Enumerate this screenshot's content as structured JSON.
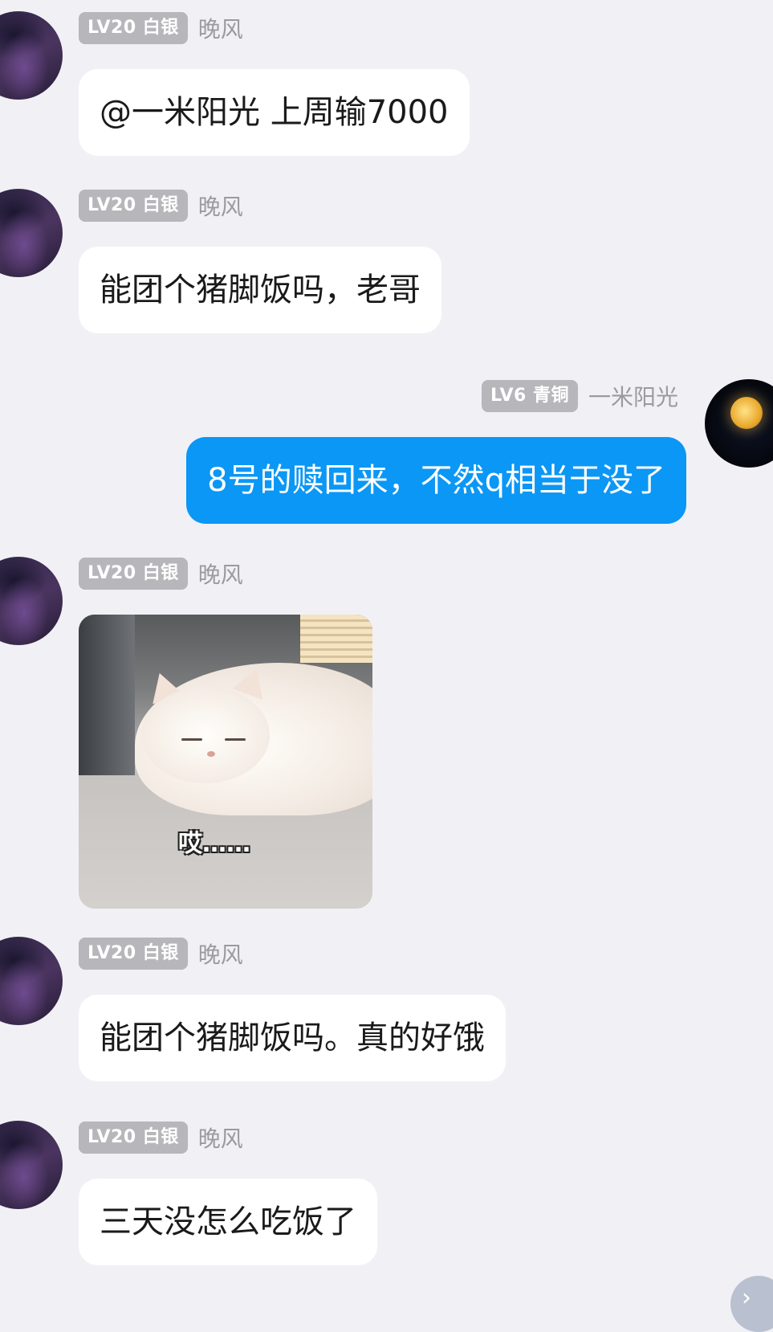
{
  "messages": [
    {
      "side": "left",
      "level": "LV20 白银",
      "name": "晚风",
      "text": "@一米阳光 上周输7000"
    },
    {
      "side": "left",
      "level": "LV20 白银",
      "name": "晚风",
      "text": "能团个猪脚饭吗，老哥"
    },
    {
      "side": "right",
      "level": "LV6 青铜",
      "name": "一米阳光",
      "text": "8号的赎回来，不然q相当于没了"
    },
    {
      "side": "left",
      "level": "LV20 白银",
      "name": "晚风",
      "image_caption": "哎……"
    },
    {
      "side": "left",
      "level": "LV20 白银",
      "name": "晚风",
      "text": "能团个猪脚饭吗。真的好饿"
    },
    {
      "side": "left",
      "level": "LV20 白银",
      "name": "晚风",
      "text": "三天没怎么吃饭了"
    }
  ],
  "scroll_button": {
    "icon": "chevron-right-icon"
  },
  "colors": {
    "background": "#f1f1f5",
    "self_bubble": "#0b97f5",
    "other_bubble": "#ffffff",
    "badge": "#b7b7bb"
  }
}
